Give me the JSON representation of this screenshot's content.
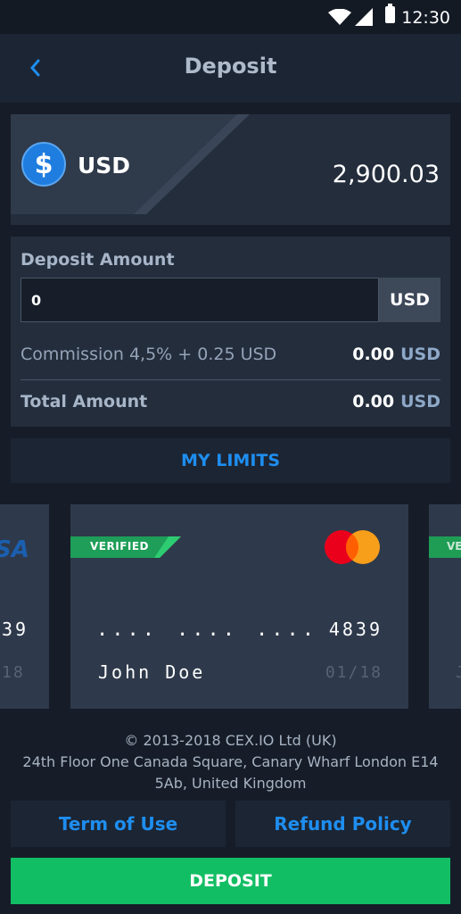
{
  "status_bar": {
    "time": "12:30",
    "icons": [
      "wifi-icon",
      "signal-icon",
      "battery-icon"
    ]
  },
  "header": {
    "title": "Deposit",
    "back_icon": "chevron-left-icon"
  },
  "currency": {
    "symbol": "$",
    "code": "USD",
    "balance": "2,900.03",
    "icon": "dollar-coin-icon"
  },
  "deposit": {
    "label": "Deposit Amount",
    "input_value": "0",
    "input_currency": "USD",
    "commission_label": "Commission 4,5% + 0.25 USD",
    "commission_value": "0.00",
    "commission_currency": "USD",
    "total_label": "Total Amount",
    "total_value": "0.00",
    "total_currency": "USD"
  },
  "limits_label": "MY LIMITS",
  "cards": {
    "left": {
      "brand": "SA",
      "number_fragment": "39",
      "expiry_fragment": "18"
    },
    "main": {
      "badge": "VERIFIED",
      "brand_icon": "mastercard-icon",
      "masked_groups": [
        "....",
        "....",
        "...."
      ],
      "last4": "4839",
      "holder": "John Doe",
      "expiry": "01/18"
    },
    "right": {
      "badge_fragment": "VE",
      "expiry_fragment": "J"
    }
  },
  "footer": {
    "line1": "© 2013-2018 CEX.IO Ltd (UK)",
    "line2": "24th Floor One Canada Square, Canary Wharf London E14",
    "line3": "5Ab, United Kingdom",
    "terms_label": "Term of Use",
    "refund_label": "Refund Policy"
  },
  "deposit_button_label": "DEPOSIT",
  "colors": {
    "background": "#161d28",
    "panel": "#232d3c",
    "accent_blue": "#1e8ef0",
    "deposit_green": "#12be64",
    "verified_green": "#1fb365",
    "mastercard_red": "#eb001b",
    "mastercard_orange": "#f79e1b"
  }
}
